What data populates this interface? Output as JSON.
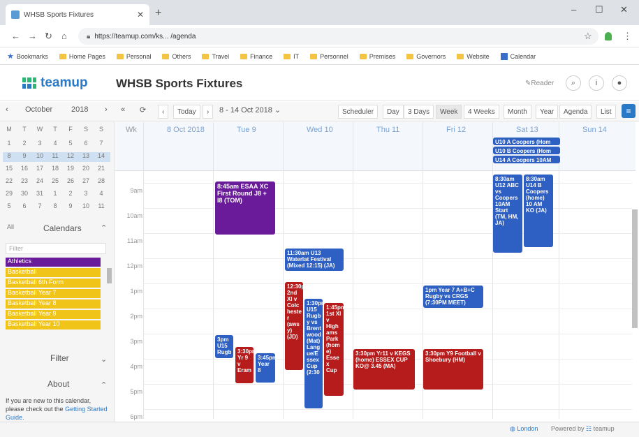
{
  "browser": {
    "tab_title": "WHSB Sports Fixtures",
    "new_tab": "+",
    "url": "https://teamup.com/ks... /agenda",
    "window_controls": [
      "–",
      "☐",
      "✕"
    ],
    "bookmarks": [
      "Bookmarks",
      "Home Pages",
      "Personal",
      "Others",
      "Travel",
      "Finance",
      "IT",
      "Personnel",
      "Premises",
      "Governors",
      "Website",
      "Calendar"
    ]
  },
  "app": {
    "logo": "teamup",
    "title": "WHSB Sports Fixtures",
    "reader": "Reader"
  },
  "toolbar": {
    "month": "October",
    "year": "2018",
    "today": "Today",
    "range": "8 - 14 Oct 2018",
    "views": [
      "Scheduler",
      "Day",
      "3 Days",
      "Week",
      "4 Weeks",
      "Month",
      "Year",
      "Agenda",
      "List"
    ],
    "active_view": "Week"
  },
  "mini_calendar": {
    "headers": [
      "M",
      "T",
      "W",
      "T",
      "F",
      "S",
      "S"
    ],
    "weeks": [
      [
        "1",
        "2",
        "3",
        "4",
        "5",
        "6",
        "7"
      ],
      [
        "8",
        "9",
        "10",
        "11",
        "12",
        "13",
        "14"
      ],
      [
        "15",
        "16",
        "17",
        "18",
        "19",
        "20",
        "21"
      ],
      [
        "22",
        "23",
        "24",
        "25",
        "26",
        "27",
        "28"
      ],
      [
        "29",
        "30",
        "31",
        "1",
        "2",
        "3",
        "4"
      ],
      [
        "5",
        "6",
        "7",
        "8",
        "9",
        "10",
        "11"
      ]
    ]
  },
  "sidebar": {
    "calendars_all": "All",
    "calendars_label": "Calendars",
    "filter_placeholder": "Filter",
    "calendars": [
      {
        "name": "Athletics",
        "color": "#6a1b9a"
      },
      {
        "name": "Basketball",
        "color": "#f0c419"
      },
      {
        "name": "Basketball 6th Form",
        "color": "#f0c419"
      },
      {
        "name": "Basketball Year 7",
        "color": "#f0c419"
      },
      {
        "name": "Basketball Year 8",
        "color": "#f0c419"
      },
      {
        "name": "Basketball Year 9",
        "color": "#f0c419"
      },
      {
        "name": "Basketball Year 10",
        "color": "#f0c419"
      }
    ],
    "filter_label": "Filter",
    "about_label": "About",
    "about_text": "If you are new to this calendar, please check out the",
    "about_link": "Getting Started Guide."
  },
  "grid": {
    "week_label": "Wk",
    "days": [
      "8 Oct 2018",
      "Tue 9",
      "Wed 10",
      "Thu 11",
      "Fri 12",
      "Sat 13",
      "Sun 14"
    ],
    "times": [
      "9am",
      "10am",
      "11am",
      "12pm",
      "1pm",
      "2pm",
      "3pm",
      "4pm",
      "5pm",
      "6pm"
    ]
  },
  "events": {
    "sat_allday_1": "U10 A Coopers (Hom",
    "sat_allday_2": "U10 B Coopers (Hom",
    "sat_allday_3": "U14 A Coopers 10AM",
    "sat_a": "8:30am U12 ABC vs Coopers 10AM Start (TM, HM, JA)",
    "sat_b": "8:30am U14 B Coopers (home) 10 AM KO (JA)",
    "tue_essaa": "8:45am ESAA XC First Round J8 + I8 (TOM)",
    "wed_waterlat": "11:30am U13 Waterlat Festival (Mixed 12:15) (JA)",
    "fri_rugby": "1pm Year 7 A+B+C Rugby vs CRGS (7:30PM MEET)",
    "wed_red1": "12:30p 2nd XI v Colc heste r (aws y) (JD)",
    "wed_blue2": "1:30pm U15 Rugb y vs Brent wood (Mat) Lang ue/E ssex Cup (2:30",
    "wed_red3": "1:45pm 1st XI v High ams Park (hom e) Esse x Cup",
    "tue_blue4": "3pm U15 Rugb",
    "tue_red5": "3:30pm Yr 9 v Eram",
    "tue_blue6": "3:45pm Year 8",
    "thu_red7": "3:30pm Yr11 v KEGS (home) ESSEX CUP KO@ 3.45 (MA)",
    "fri_red8": "3:30pm Y9 Football v Shoebury (HM)"
  },
  "footer": {
    "location": "London",
    "powered": "Powered by",
    "brand": "teamup"
  },
  "colors": {
    "accent": "#2a79c7",
    "event_blue": "#2e5fc2",
    "event_red": "#b71c1c",
    "event_purple": "#6a1b9a",
    "calendar_yellow": "#f0c419"
  }
}
